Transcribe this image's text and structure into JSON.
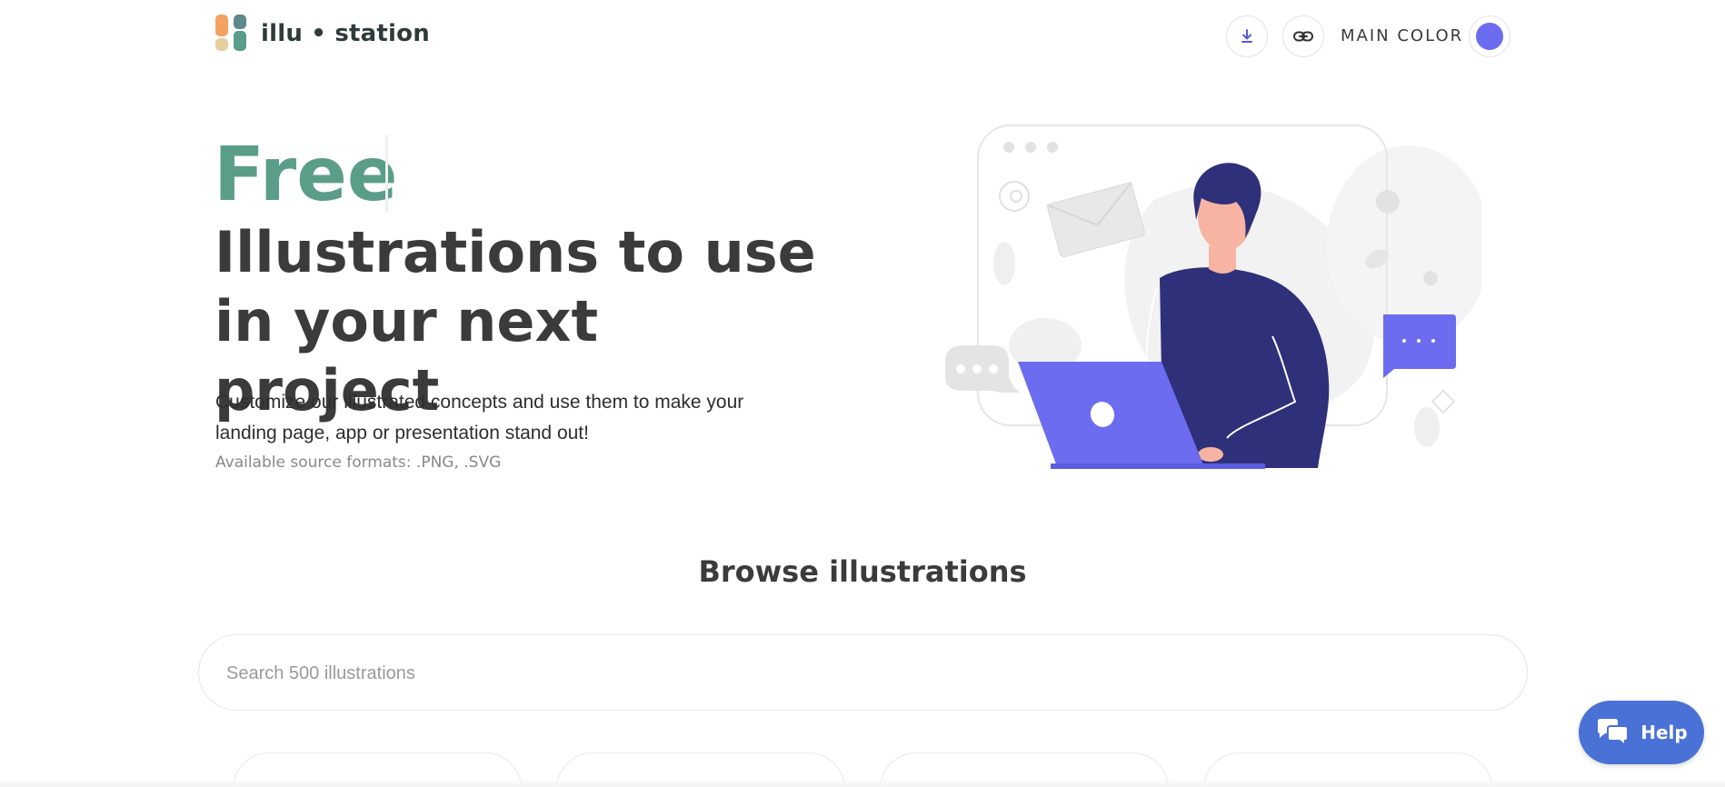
{
  "header": {
    "brand": "illu • station",
    "download_icon": "download-icon",
    "link_icon": "link-icon",
    "main_color_label": "MAIN COLOR",
    "main_color_value": "#6c6cf0"
  },
  "hero": {
    "highlight": "Free",
    "title": "Illustrations to use in your next project",
    "description": "Customize our illustrated concepts and use them to make your landing page, app or presentation stand out!",
    "formats": "Available source formats: .PNG, .SVG"
  },
  "browse": {
    "title": "Browse illustrations",
    "search_placeholder": "Search 500 illustrations"
  },
  "help": {
    "label": "Help",
    "icon": "chat-icon"
  },
  "colors": {
    "accent": "#6c6cf0",
    "brand_green": "#5a9e89",
    "help_blue": "#4a72d6"
  }
}
